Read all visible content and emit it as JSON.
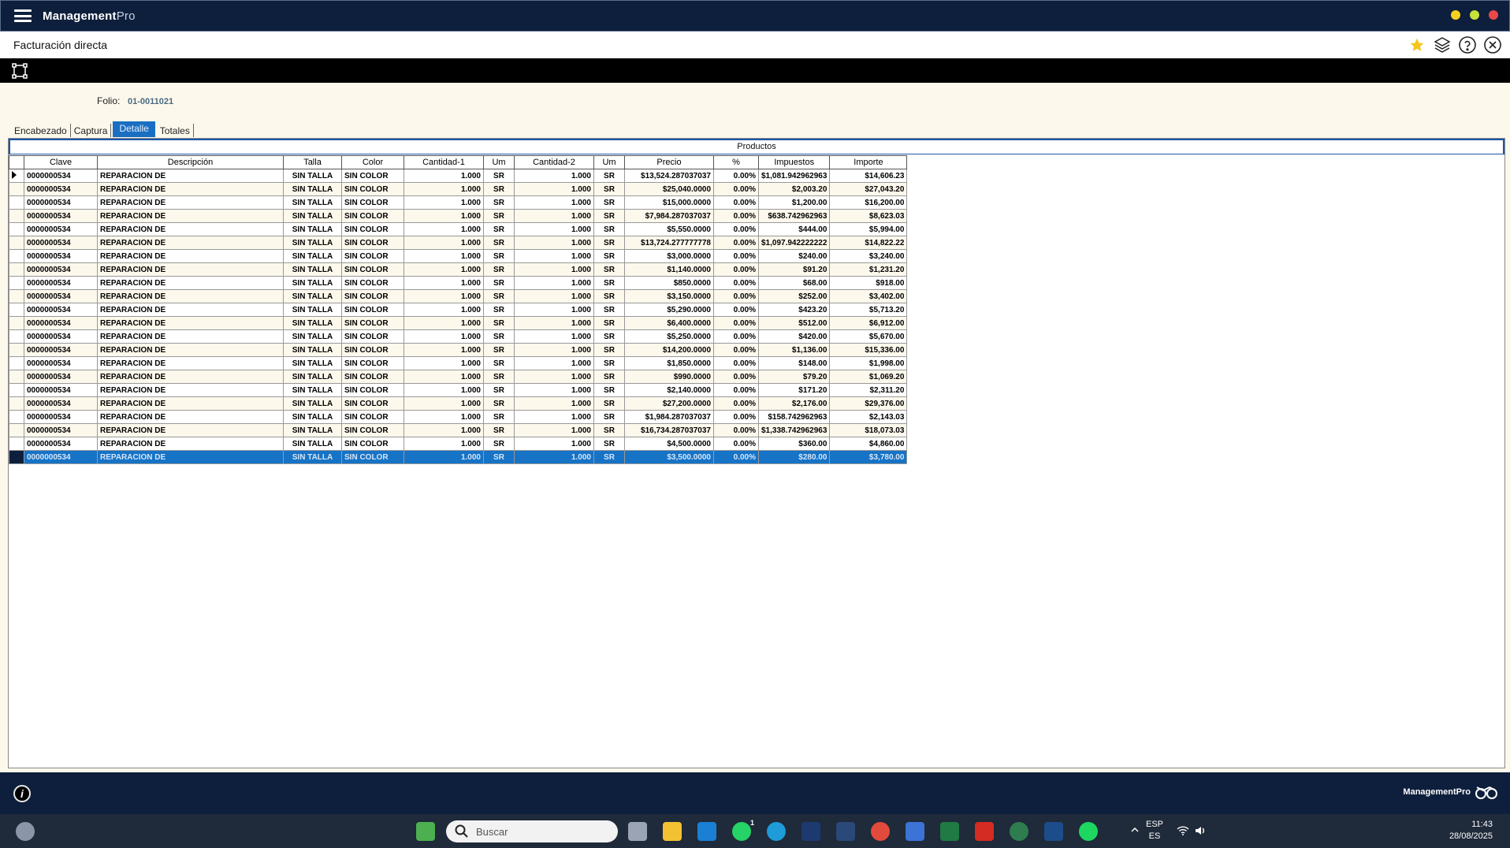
{
  "app": {
    "brand_bold": "Management",
    "brand_light": "Pro"
  },
  "colors": {
    "dot1": "#f5d020",
    "dot2": "#c6e33b",
    "dot3": "#e84848",
    "accent": "#1673c6",
    "titlebar": "#0d1f3c"
  },
  "form": {
    "title": "Facturación directa"
  },
  "header_icons": [
    "star-icon",
    "layers-icon",
    "help-icon",
    "close-icon"
  ],
  "folio": {
    "label": "Folio:",
    "value": "01-0011021"
  },
  "tabs": [
    {
      "label": "Encabezado"
    },
    {
      "label": "Captura"
    },
    {
      "label": "Detalle",
      "active": true
    },
    {
      "label": "Totales"
    }
  ],
  "grid": {
    "title": "Productos",
    "columns": [
      "Clave",
      "Descripción",
      "Talla",
      "Color",
      "Cantidad-1",
      "Um",
      "Cantidad-2",
      "Um",
      "Precio",
      "%",
      "Impuestos",
      "Importe"
    ],
    "rows": [
      [
        "0000000534",
        "REPARACION DE",
        "SIN TALLA",
        "SIN COLOR",
        "1.000",
        "SR",
        "1.000",
        "SR",
        "$13,524.287037037",
        "0.00%",
        "$1,081.942962963",
        "$14,606.23"
      ],
      [
        "0000000534",
        "REPARACION DE",
        "SIN TALLA",
        "SIN COLOR",
        "1.000",
        "SR",
        "1.000",
        "SR",
        "$25,040.0000",
        "0.00%",
        "$2,003.20",
        "$27,043.20"
      ],
      [
        "0000000534",
        "REPARACION DE",
        "SIN TALLA",
        "SIN COLOR",
        "1.000",
        "SR",
        "1.000",
        "SR",
        "$15,000.0000",
        "0.00%",
        "$1,200.00",
        "$16,200.00"
      ],
      [
        "0000000534",
        "REPARACION DE",
        "SIN TALLA",
        "SIN COLOR",
        "1.000",
        "SR",
        "1.000",
        "SR",
        "$7,984.287037037",
        "0.00%",
        "$638.742962963",
        "$8,623.03"
      ],
      [
        "0000000534",
        "REPARACION DE",
        "SIN TALLA",
        "SIN COLOR",
        "1.000",
        "SR",
        "1.000",
        "SR",
        "$5,550.0000",
        "0.00%",
        "$444.00",
        "$5,994.00"
      ],
      [
        "0000000534",
        "REPARACION DE",
        "SIN TALLA",
        "SIN COLOR",
        "1.000",
        "SR",
        "1.000",
        "SR",
        "$13,724.277777778",
        "0.00%",
        "$1,097.942222222",
        "$14,822.22"
      ],
      [
        "0000000534",
        "REPARACION DE",
        "SIN TALLA",
        "SIN COLOR",
        "1.000",
        "SR",
        "1.000",
        "SR",
        "$3,000.0000",
        "0.00%",
        "$240.00",
        "$3,240.00"
      ],
      [
        "0000000534",
        "REPARACION DE",
        "SIN TALLA",
        "SIN COLOR",
        "1.000",
        "SR",
        "1.000",
        "SR",
        "$1,140.0000",
        "0.00%",
        "$91.20",
        "$1,231.20"
      ],
      [
        "0000000534",
        "REPARACION DE",
        "SIN TALLA",
        "SIN COLOR",
        "1.000",
        "SR",
        "1.000",
        "SR",
        "$850.0000",
        "0.00%",
        "$68.00",
        "$918.00"
      ],
      [
        "0000000534",
        "REPARACION DE",
        "SIN TALLA",
        "SIN COLOR",
        "1.000",
        "SR",
        "1.000",
        "SR",
        "$3,150.0000",
        "0.00%",
        "$252.00",
        "$3,402.00"
      ],
      [
        "0000000534",
        "REPARACION DE",
        "SIN TALLA",
        "SIN COLOR",
        "1.000",
        "SR",
        "1.000",
        "SR",
        "$5,290.0000",
        "0.00%",
        "$423.20",
        "$5,713.20"
      ],
      [
        "0000000534",
        "REPARACION DE",
        "SIN TALLA",
        "SIN COLOR",
        "1.000",
        "SR",
        "1.000",
        "SR",
        "$6,400.0000",
        "0.00%",
        "$512.00",
        "$6,912.00"
      ],
      [
        "0000000534",
        "REPARACION DE",
        "SIN TALLA",
        "SIN COLOR",
        "1.000",
        "SR",
        "1.000",
        "SR",
        "$5,250.0000",
        "0.00%",
        "$420.00",
        "$5,670.00"
      ],
      [
        "0000000534",
        "REPARACION DE",
        "SIN TALLA",
        "SIN COLOR",
        "1.000",
        "SR",
        "1.000",
        "SR",
        "$14,200.0000",
        "0.00%",
        "$1,136.00",
        "$15,336.00"
      ],
      [
        "0000000534",
        "REPARACION DE",
        "SIN TALLA",
        "SIN COLOR",
        "1.000",
        "SR",
        "1.000",
        "SR",
        "$1,850.0000",
        "0.00%",
        "$148.00",
        "$1,998.00"
      ],
      [
        "0000000534",
        "REPARACION DE",
        "SIN TALLA",
        "SIN COLOR",
        "1.000",
        "SR",
        "1.000",
        "SR",
        "$990.0000",
        "0.00%",
        "$79.20",
        "$1,069.20"
      ],
      [
        "0000000534",
        "REPARACION DE",
        "SIN TALLA",
        "SIN COLOR",
        "1.000",
        "SR",
        "1.000",
        "SR",
        "$2,140.0000",
        "0.00%",
        "$171.20",
        "$2,311.20"
      ],
      [
        "0000000534",
        "REPARACION DE",
        "SIN TALLA",
        "SIN COLOR",
        "1.000",
        "SR",
        "1.000",
        "SR",
        "$27,200.0000",
        "0.00%",
        "$2,176.00",
        "$29,376.00"
      ],
      [
        "0000000534",
        "REPARACION DE",
        "SIN TALLA",
        "SIN COLOR",
        "1.000",
        "SR",
        "1.000",
        "SR",
        "$1,984.287037037",
        "0.00%",
        "$158.742962963",
        "$2,143.03"
      ],
      [
        "0000000534",
        "REPARACION DE",
        "SIN TALLA",
        "SIN COLOR",
        "1.000",
        "SR",
        "1.000",
        "SR",
        "$16,734.287037037",
        "0.00%",
        "$1,338.742962963",
        "$18,073.03"
      ],
      [
        "0000000534",
        "REPARACION DE",
        "SIN TALLA",
        "SIN COLOR",
        "1.000",
        "SR",
        "1.000",
        "SR",
        "$4,500.0000",
        "0.00%",
        "$360.00",
        "$4,860.00"
      ]
    ],
    "selected_row": [
      "0000000534",
      "REPARACION DE",
      "SIN TALLA",
      "SIN COLOR",
      "1.000",
      "SR",
      "1.000",
      "SR",
      "$3,500.0000",
      "0.00%",
      "$280.00",
      "$3,780.00"
    ]
  },
  "footer": {
    "brand": "ManagementPro"
  },
  "taskbar": {
    "search_placeholder": "Buscar",
    "lang_top": "ESP",
    "lang_bottom": "ES",
    "time": "11:43",
    "date": "28/08/2025",
    "whatsapp_badge": "1"
  }
}
